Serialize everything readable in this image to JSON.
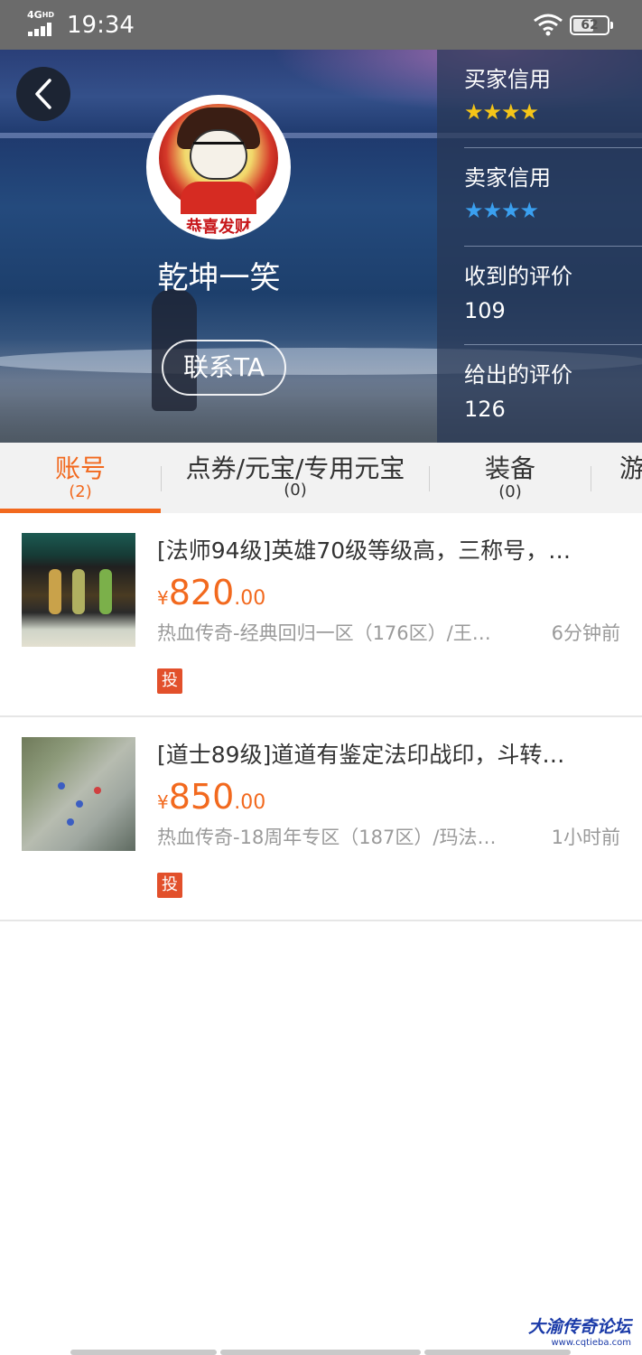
{
  "status_bar": {
    "network": "4G",
    "network_sup": "HD",
    "time": "19:34",
    "battery": "62",
    "battery_level_percent": 62,
    "icons": [
      "signal-icon",
      "wifi-icon",
      "battery-icon"
    ]
  },
  "profile": {
    "back_icon": "chevron-left-icon",
    "avatar_caption": "恭喜发财",
    "nickname": "乾坤一笑",
    "contact_label": "联系TA"
  },
  "stats": {
    "buyer_credit_label": "买家信用",
    "buyer_credit_stars": 4,
    "buyer_star_color": "#f5c518",
    "seller_credit_label": "卖家信用",
    "seller_credit_stars": 4,
    "seller_star_color": "#3aa0f0",
    "received_reviews_label": "收到的评价",
    "received_reviews_value": "109",
    "given_reviews_label": "给出的评价",
    "given_reviews_value": "126"
  },
  "tabs": [
    {
      "label": "账号",
      "count": "(2)",
      "active": true
    },
    {
      "label": "点券/元宝/专用元宝",
      "count": "(0)",
      "active": false
    },
    {
      "label": "装备",
      "count": "(0)",
      "active": false
    },
    {
      "label": "游",
      "count": "",
      "active": false
    }
  ],
  "listings": [
    {
      "title": "[法师94级]英雄70级等级高，三称号，…",
      "currency": "¥",
      "price_int": "820",
      "price_dec": ".00",
      "server": "热血传奇-经典回归一区（176区）/王…",
      "time": "6分钟前",
      "tag": "投"
    },
    {
      "title": "[道士89级]道道有鉴定法印战印，斗转…",
      "currency": "¥",
      "price_int": "850",
      "price_dec": ".00",
      "server": "热血传奇-18周年专区（187区）/玛法…",
      "time": "1小时前",
      "tag": "投"
    }
  ],
  "colors": {
    "accent": "#f2691e",
    "tag_bg": "#e2502b"
  },
  "watermark": {
    "main": "大渝传奇论坛",
    "url": "www.cqtieba.com"
  }
}
